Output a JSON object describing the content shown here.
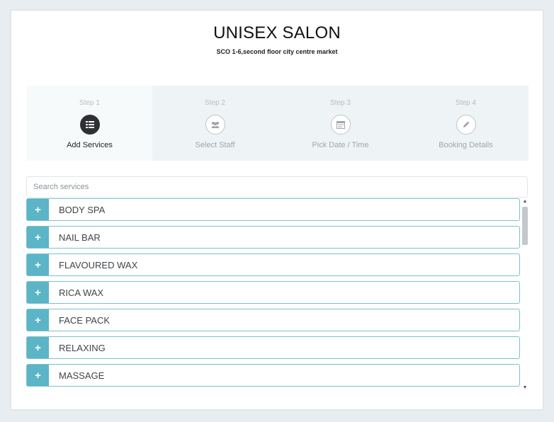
{
  "header": {
    "title": "UNISEX SALON",
    "address": "SCO 1-6,second floor city centre market"
  },
  "steps": [
    {
      "num": "Step 1",
      "label": "Add Services",
      "icon": "list-icon",
      "active": true
    },
    {
      "num": "Step 2",
      "label": "Select Staff",
      "icon": "users-icon",
      "active": false
    },
    {
      "num": "Step 3",
      "label": "Pick Date / Time",
      "icon": "calendar-icon",
      "active": false
    },
    {
      "num": "Step 4",
      "label": "Booking Details",
      "icon": "pencil-icon",
      "active": false
    }
  ],
  "search": {
    "placeholder": "Search services",
    "value": ""
  },
  "services": [
    {
      "label": "BODY SPA",
      "add": "+"
    },
    {
      "label": "NAIL BAR",
      "add": "+"
    },
    {
      "label": "FLAVOURED WAX",
      "add": "+"
    },
    {
      "label": "RICA WAX",
      "add": "+"
    },
    {
      "label": "FACE PACK",
      "add": "+"
    },
    {
      "label": "RELAXING",
      "add": "+"
    },
    {
      "label": "MASSAGE",
      "add": "+"
    }
  ],
  "scrollbar": {
    "up": "▲",
    "down": "▼"
  },
  "colors": {
    "accent": "#5bb5c6",
    "item_border": "#7cc0cd",
    "active_icon": "#2f3033",
    "steps_bg": "#eef3f5"
  }
}
